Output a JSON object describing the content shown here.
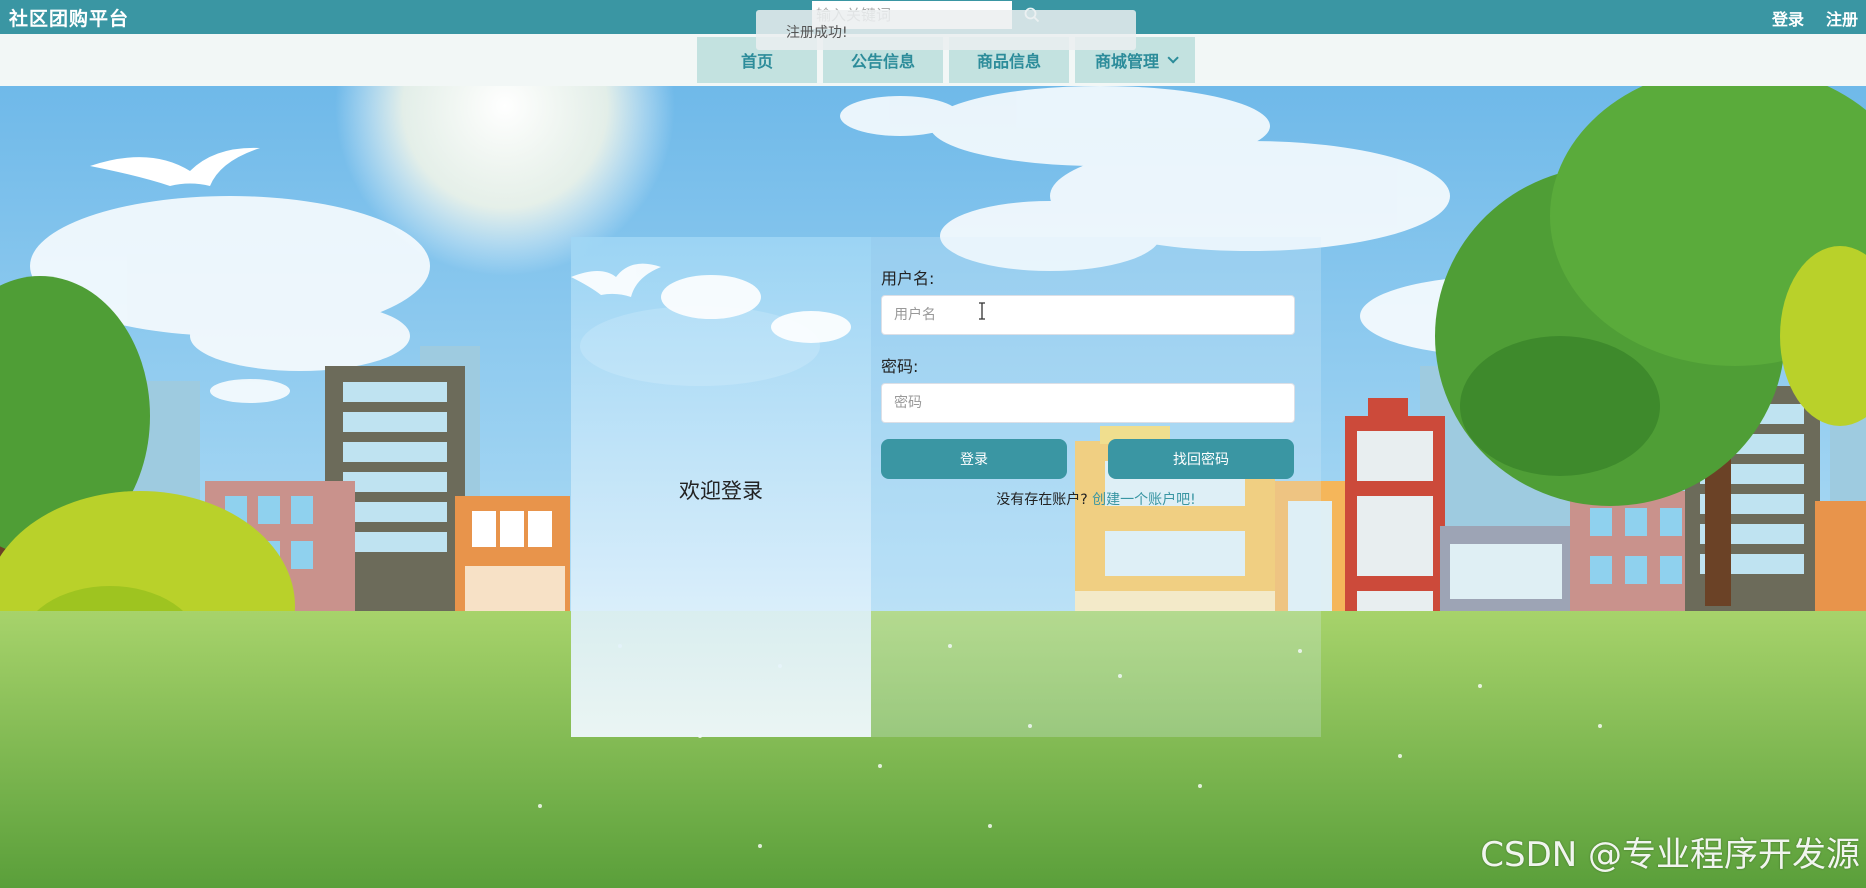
{
  "header": {
    "brand": "社区团购平台",
    "search_placeholder": "输入关键词",
    "login_link": "登录",
    "register_link": "注册"
  },
  "nav": {
    "items": [
      {
        "label": "首页"
      },
      {
        "label": "公告信息"
      },
      {
        "label": "商品信息"
      },
      {
        "label": "商城管理"
      }
    ]
  },
  "toast": {
    "message": "注册成功!"
  },
  "login": {
    "welcome": "欢迎登录",
    "username_label": "用户名:",
    "username_placeholder": "用户名",
    "password_label": "密码:",
    "password_placeholder": "密码",
    "login_button": "登录",
    "forgot_button": "找回密码",
    "no_account_text": "没有存在账户?",
    "create_account_link": "创建一个账户吧!"
  },
  "watermark": "CSDN @专业程序开发源",
  "colors": {
    "primary": "#3a96a3",
    "nav_item_bg": "#c3e2e0",
    "nav_text": "#2c8c9a"
  }
}
